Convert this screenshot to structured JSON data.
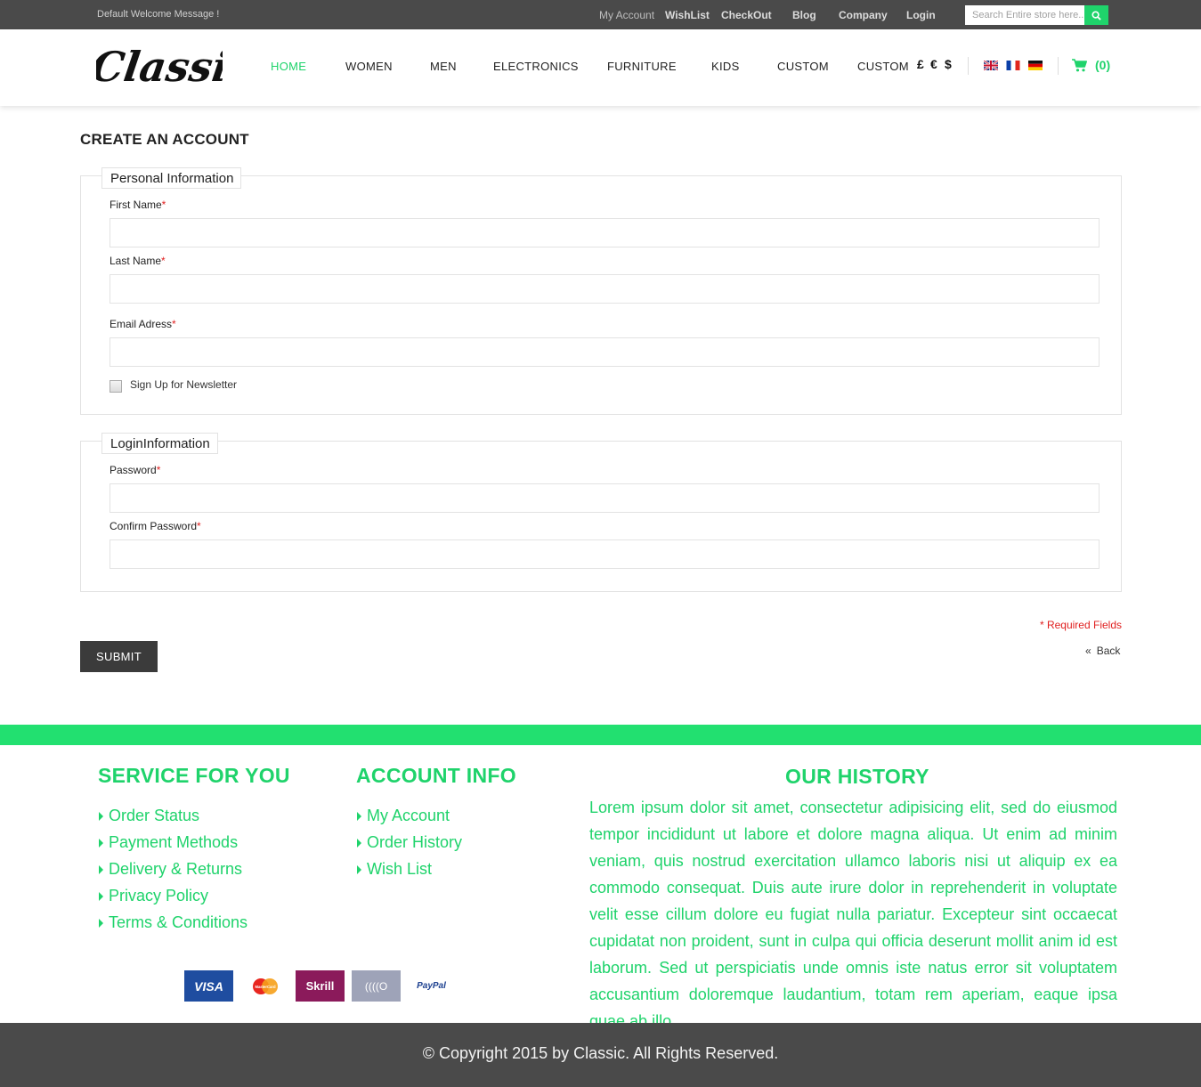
{
  "topbar": {
    "welcome": "Default Welcome Message !",
    "links": [
      "My Account",
      "WishList",
      "CheckOut",
      "Blog",
      "Company",
      "Login"
    ],
    "search_placeholder": "Search Entire store here..."
  },
  "header": {
    "logo_text": "Classic",
    "nav": [
      "HOME",
      "WOMEN",
      "MEN",
      "ELECTRONICS",
      "FURNITURE",
      "KIDS",
      "CUSTOM",
      "CUSTOM"
    ],
    "currencies": [
      "£",
      "€",
      "$"
    ],
    "flags": [
      "uk-flag-icon",
      "france-flag-icon",
      "germany-flag-icon"
    ],
    "cart_count": "(0)"
  },
  "page": {
    "title": "CREATE AN ACCOUNT",
    "personal": {
      "legend": "Personal Information",
      "first_name": "First Name",
      "last_name": "Last Name",
      "email": "Email Adress",
      "newsletter": "Sign Up for Newsletter"
    },
    "login": {
      "legend": "LoginInformation",
      "password": "Password",
      "confirm": "Confirm Password"
    },
    "required_mark": "*",
    "required_note": "* Required Fields",
    "submit": "SUBMIT",
    "back": "Back"
  },
  "footer": {
    "service_title": "SERVICE FOR YOU",
    "service_links": [
      "Order Status",
      "Payment Methods",
      "Delivery & Returns",
      "Privacy Policy",
      "Terms & Conditions"
    ],
    "account_title": "ACCOUNT INFO",
    "account_links": [
      "My Account",
      "Order History",
      "Wish List"
    ],
    "history_title": "OUR HISTORY",
    "history_text": "Lorem ipsum dolor sit amet, consectetur adipisicing elit, sed do eiusmod tempor incididunt ut labore et dolore magna aliqua. Ut enim ad minim veniam, quis nostrud exercitation ullamco laboris nisi ut aliquip ex ea commodo consequat. Duis aute irure dolor in reprehenderit in voluptate velit esse cillum dolore eu fugiat nulla pariatur. Excepteur sint occaecat cupidatat non proident, sunt in culpa qui officia deserunt mollit anim id est laborum. Sed ut perspiciatis unde omnis iste natus error sit voluptatem accusantium doloremque laudantium, totam rem aperiam, eaque ipsa quae ab illo.",
    "payments": [
      "VISA",
      "MasterCard",
      "Skrill",
      "((((O",
      "PayPal"
    ],
    "copyright": "© Copyright 2015 by Classic. All Rights Reserved."
  },
  "colors": {
    "accent": "#1fd36b",
    "dark": "#4a4a4a",
    "required": "#e02020"
  }
}
